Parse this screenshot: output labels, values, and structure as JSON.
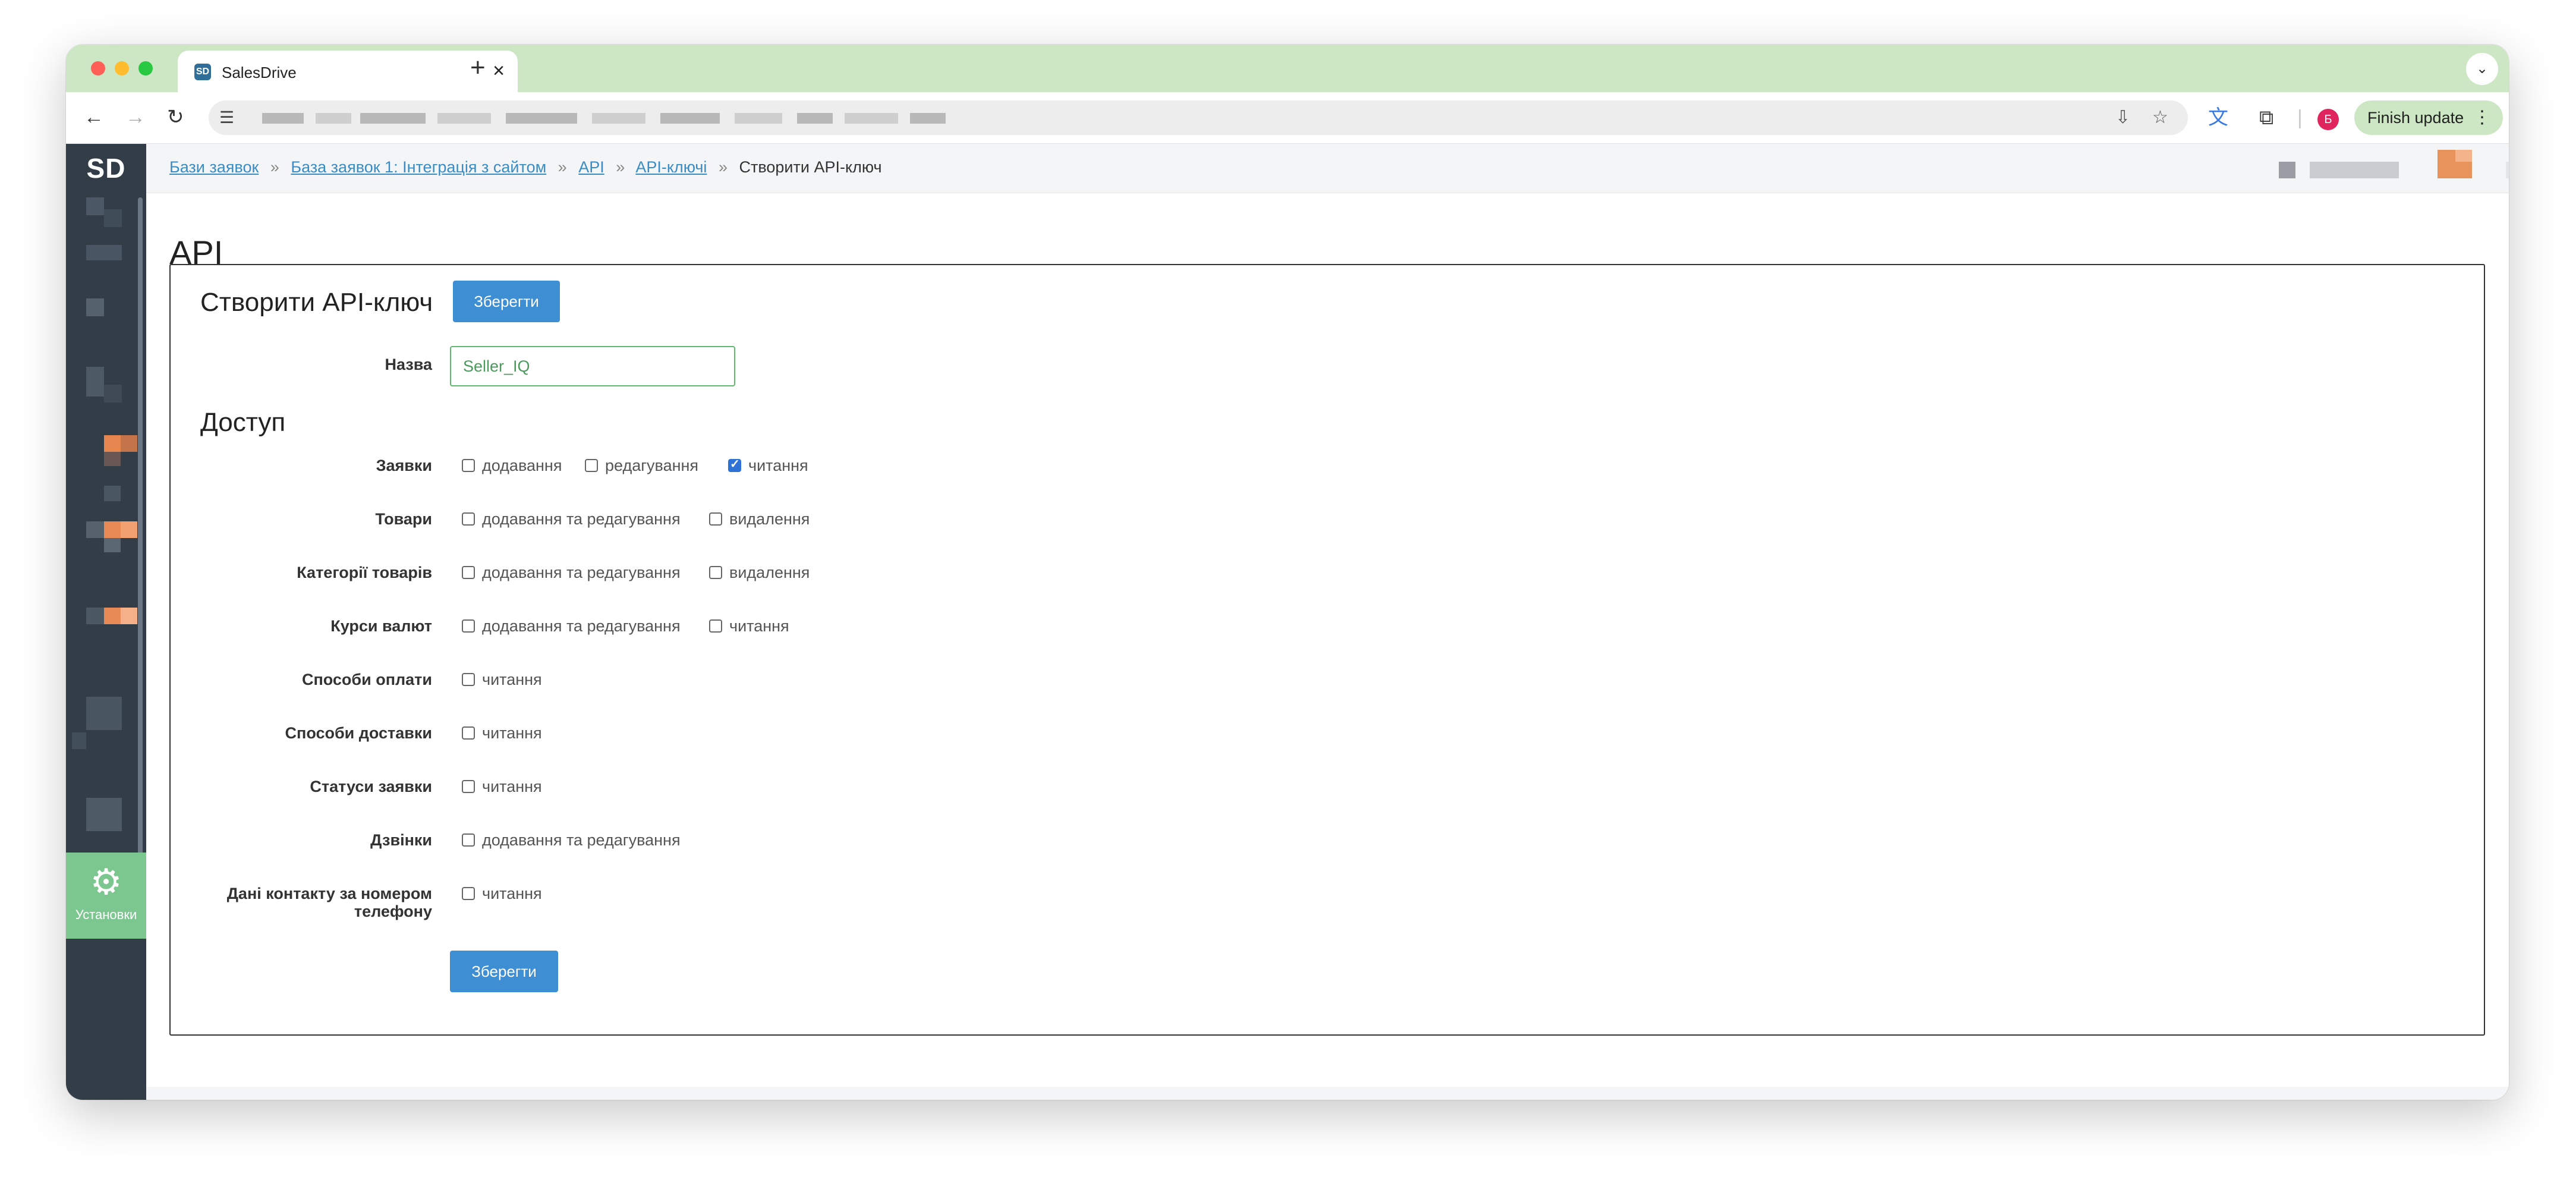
{
  "browser": {
    "tab_title": "SalesDrive",
    "tab_favicon": "SD",
    "finish_update_label": "Finish update",
    "profile_initial": "Б",
    "icons": {
      "close_tab": "×",
      "new_tab": "+",
      "tab_list": "⌄",
      "back": "←",
      "forward": "→",
      "reload": "↻",
      "site_settings": "☰",
      "install": "⇩",
      "bookmark": "☆",
      "translate": "文",
      "extensions": "⧉",
      "menu": "⋮"
    }
  },
  "sidebar": {
    "logo": "SD",
    "settings_label": "Установки",
    "settings_icon": "⚙"
  },
  "breadcrumb": {
    "items": [
      "Бази заявок",
      "База заявок 1: Інтеграція з сайтом",
      "API",
      "API-ключі"
    ],
    "current": "Створити API-ключ",
    "separator": "»"
  },
  "page": {
    "title": "API",
    "form_title": "Створити API-ключ",
    "save_label": "Зберегти",
    "name_label": "Назва",
    "name_value": "Seller_IQ",
    "section_title": "Доступ"
  },
  "access": [
    {
      "label": "Заявки",
      "options": [
        {
          "text": "додавання",
          "checked": false
        },
        {
          "text": "редагування",
          "checked": false
        },
        {
          "text": "читання",
          "checked": true
        }
      ]
    },
    {
      "label": "Товари",
      "options": [
        {
          "text": "додавання та редагування",
          "checked": false
        },
        {
          "text": "видалення",
          "checked": false
        }
      ]
    },
    {
      "label": "Категорії товарів",
      "options": [
        {
          "text": "додавання та редагування",
          "checked": false
        },
        {
          "text": "видалення",
          "checked": false
        }
      ]
    },
    {
      "label": "Курси валют",
      "options": [
        {
          "text": "додавання та редагування",
          "checked": false
        },
        {
          "text": "читання",
          "checked": false
        }
      ]
    },
    {
      "label": "Способи оплати",
      "options": [
        {
          "text": "читання",
          "checked": false
        }
      ]
    },
    {
      "label": "Способи доставки",
      "options": [
        {
          "text": "читання",
          "checked": false
        }
      ]
    },
    {
      "label": "Статуси заявки",
      "options": [
        {
          "text": "читання",
          "checked": false
        }
      ]
    },
    {
      "label": "Дзвінки",
      "options": [
        {
          "text": "додавання та редагування",
          "checked": false
        }
      ]
    },
    {
      "label_line1": "Дані контакту за номером",
      "label_line2": "телефону",
      "options": [
        {
          "text": "читання",
          "checked": false
        }
      ]
    }
  ],
  "colors": {
    "accent": "#3d8ed3",
    "sidebar": "#323d48",
    "settings_active": "#7cc68f",
    "tab_strip": "#cde7c4",
    "link": "#3a8cc4"
  }
}
